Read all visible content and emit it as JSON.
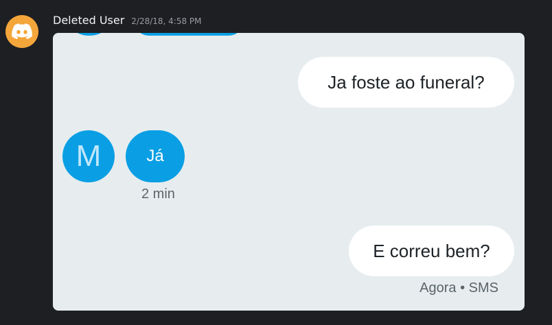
{
  "message": {
    "author": "Deleted User",
    "timestamp": "2/28/18, 4:58 PM",
    "avatar_icon": "discord-logo-icon",
    "avatar_color": "#f4a63b"
  },
  "screenshot": {
    "contact_initial": "M",
    "messages": [
      {
        "direction": "outgoing",
        "text": "Ja foste ao funeral?"
      },
      {
        "direction": "incoming",
        "text": "Já",
        "meta": "2 min"
      },
      {
        "direction": "outgoing",
        "text": "E correu bem?",
        "meta": "Agora • SMS"
      }
    ],
    "colors": {
      "background": "#e7edef",
      "incoming_bubble": "#0a9fe4",
      "outgoing_bubble": "#ffffff"
    }
  }
}
